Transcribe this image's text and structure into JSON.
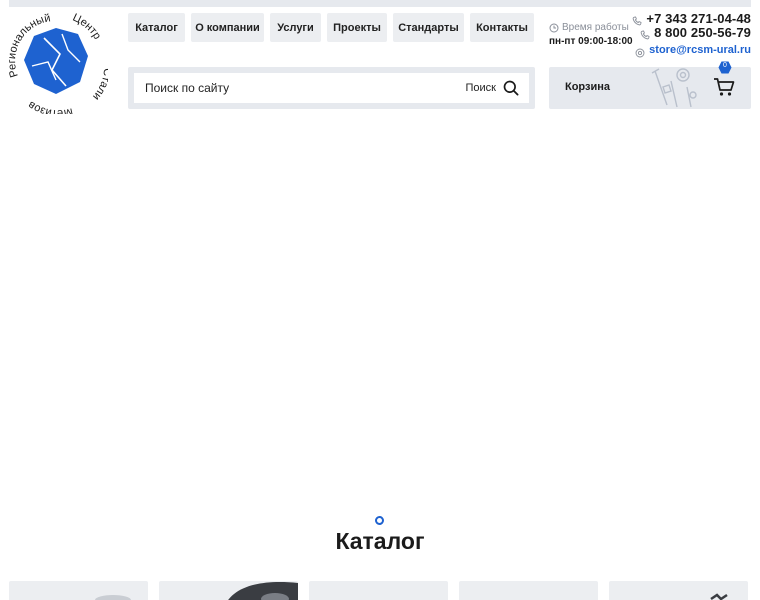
{
  "logo": {
    "text_top": "Региональный",
    "text_right_top": "Центр",
    "text_right": "Стали",
    "text_bottom": "Метизов",
    "brand_color": "#1e62d0"
  },
  "nav": {
    "items": [
      {
        "label": "Каталог"
      },
      {
        "label": "О компании"
      },
      {
        "label": "Услуги"
      },
      {
        "label": "Проекты"
      },
      {
        "label": "Стандарты"
      },
      {
        "label": "Контакты"
      }
    ]
  },
  "hours": {
    "title": "Время работы",
    "value": "пн-пт 09:00-18:00",
    "icon": "clock-icon"
  },
  "contacts": {
    "phone1": "+7 343 271-04-48",
    "phone2": "8 800 250-56-79",
    "email": "store@rcsm-ural.ru",
    "phone_icon": "phone-icon",
    "email_icon": "at-icon"
  },
  "search": {
    "placeholder": "Поиск по сайту",
    "value": "",
    "button_label": "Поиск",
    "icon": "search-icon"
  },
  "cart": {
    "label": "Корзина",
    "count": "0",
    "icon": "cart-icon",
    "badge_color": "#1e62d0"
  },
  "slider": {
    "active_dot": 1,
    "dot_color": "#1e62d0"
  },
  "catalog": {
    "title": "Каталог"
  },
  "colors": {
    "accent": "#1e62d0",
    "panel": "#e6e9ee",
    "nav_bg": "#eceef1",
    "text": "#1b1b1b",
    "muted": "#8a8f99"
  }
}
